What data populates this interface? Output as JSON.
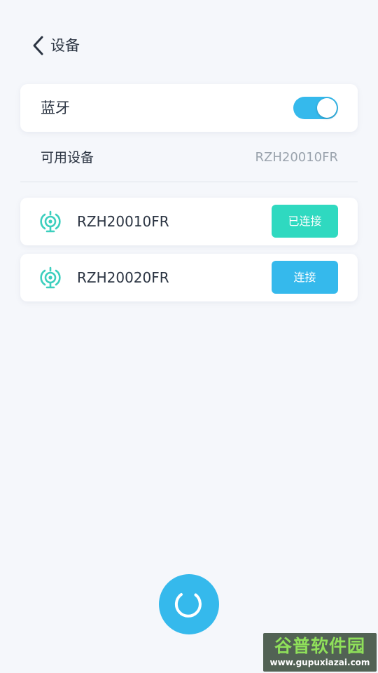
{
  "header": {
    "title": "设备",
    "back_icon": "chevron-left-icon"
  },
  "bluetooth": {
    "label": "蓝牙",
    "enabled": true
  },
  "section": {
    "label": "可用设备",
    "current_device": "RZH20010FR"
  },
  "devices": [
    {
      "name": "RZH20010FR",
      "action_label": "已连接",
      "status": "connected",
      "icon": "signal-tower-icon"
    },
    {
      "name": "RZH20020FR",
      "action_label": "连接",
      "status": "available",
      "icon": "signal-tower-icon"
    }
  ],
  "refresh": {
    "icon": "refresh-spinner-icon"
  },
  "watermark": {
    "title": "谷普软件园",
    "url": "www.gupuxiazai.com"
  },
  "colors": {
    "background": "#f5f7fb",
    "accent_blue": "#35b9ec",
    "connected_teal": "#2fd9c0",
    "icon_teal": "#3ccfbe",
    "text_primary": "#2b3442",
    "text_secondary": "#9aa3ad"
  }
}
